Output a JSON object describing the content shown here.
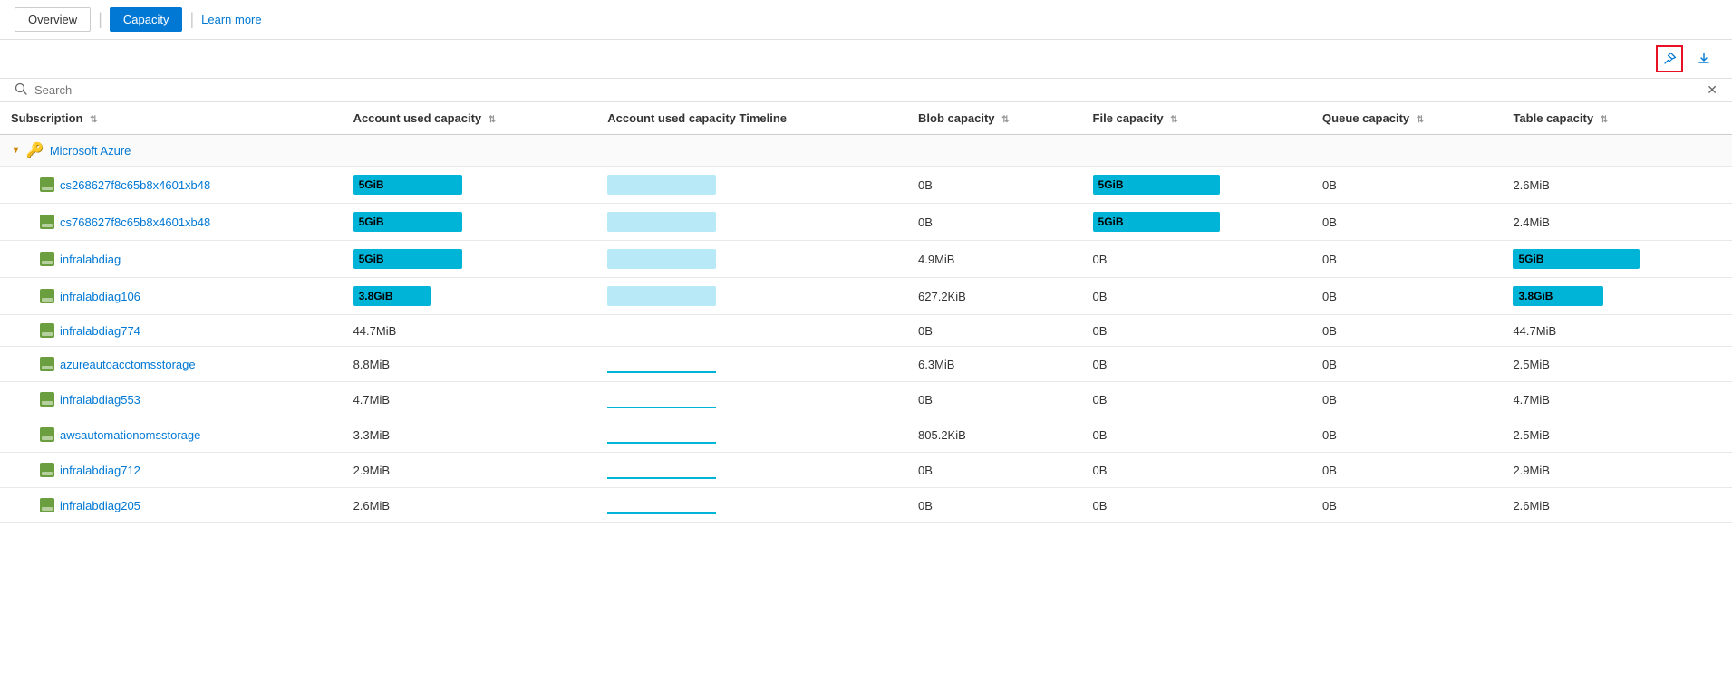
{
  "topbar": {
    "overview_label": "Overview",
    "capacity_label": "Capacity",
    "learn_more_label": "Learn more"
  },
  "toolbar": {
    "pin_icon": "📌",
    "download_icon": "⬇"
  },
  "search": {
    "placeholder": "Search",
    "clear_icon": "✕"
  },
  "table": {
    "columns": [
      {
        "key": "subscription",
        "label": "Subscription"
      },
      {
        "key": "account_used_capacity",
        "label": "Account used capacity"
      },
      {
        "key": "account_used_capacity_timeline",
        "label": "Account used capacity Timeline"
      },
      {
        "key": "blob_capacity",
        "label": "Blob capacity"
      },
      {
        "key": "file_capacity",
        "label": "File capacity"
      },
      {
        "key": "queue_capacity",
        "label": "Queue capacity"
      },
      {
        "key": "table_capacity",
        "label": "Table capacity"
      }
    ],
    "group": {
      "name": "Microsoft Azure"
    },
    "rows": [
      {
        "name": "cs268627f8c65b8x4601xb48",
        "account_used_capacity": "5GiB",
        "account_used_capacity_bar": "full",
        "timeline_bar": "light",
        "blob_capacity": "0B",
        "file_capacity": "5GiB",
        "file_capacity_bar": true,
        "queue_capacity": "0B",
        "table_capacity": "2.6MiB",
        "table_capacity_bar": false
      },
      {
        "name": "cs768627f8c65b8x4601xb48",
        "account_used_capacity": "5GiB",
        "account_used_capacity_bar": "full",
        "timeline_bar": "light",
        "blob_capacity": "0B",
        "file_capacity": "5GiB",
        "file_capacity_bar": true,
        "queue_capacity": "0B",
        "table_capacity": "2.4MiB",
        "table_capacity_bar": false
      },
      {
        "name": "infralabdiag",
        "account_used_capacity": "5GiB",
        "account_used_capacity_bar": "full",
        "timeline_bar": "light",
        "blob_capacity": "4.9MiB",
        "file_capacity": "0B",
        "file_capacity_bar": false,
        "queue_capacity": "0B",
        "table_capacity": "5GiB",
        "table_capacity_bar": true,
        "table_capacity_bar_size": "full"
      },
      {
        "name": "infralabdiag106",
        "account_used_capacity": "3.8GiB",
        "account_used_capacity_bar": "partial",
        "timeline_bar": "light",
        "blob_capacity": "627.2KiB",
        "file_capacity": "0B",
        "file_capacity_bar": false,
        "queue_capacity": "0B",
        "table_capacity": "3.8GiB",
        "table_capacity_bar": true,
        "table_capacity_bar_size": "partial"
      },
      {
        "name": "infralabdiag774",
        "account_used_capacity": "44.7MiB",
        "account_used_capacity_bar": "none",
        "timeline_bar": "none",
        "blob_capacity": "0B",
        "file_capacity": "0B",
        "file_capacity_bar": false,
        "queue_capacity": "0B",
        "table_capacity": "44.7MiB",
        "table_capacity_bar": false
      },
      {
        "name": "azureautoacctomsstorage",
        "account_used_capacity": "8.8MiB",
        "account_used_capacity_bar": "none",
        "timeline_bar": "tiny",
        "blob_capacity": "6.3MiB",
        "file_capacity": "0B",
        "file_capacity_bar": false,
        "queue_capacity": "0B",
        "table_capacity": "2.5MiB",
        "table_capacity_bar": false
      },
      {
        "name": "infralabdiag553",
        "account_used_capacity": "4.7MiB",
        "account_used_capacity_bar": "none",
        "timeline_bar": "tiny",
        "blob_capacity": "0B",
        "file_capacity": "0B",
        "file_capacity_bar": false,
        "queue_capacity": "0B",
        "table_capacity": "4.7MiB",
        "table_capacity_bar": false
      },
      {
        "name": "awsautomationomsstorage",
        "account_used_capacity": "3.3MiB",
        "account_used_capacity_bar": "none",
        "timeline_bar": "tiny",
        "blob_capacity": "805.2KiB",
        "file_capacity": "0B",
        "file_capacity_bar": false,
        "queue_capacity": "0B",
        "table_capacity": "2.5MiB",
        "table_capacity_bar": false
      },
      {
        "name": "infralabdiag712",
        "account_used_capacity": "2.9MiB",
        "account_used_capacity_bar": "none",
        "timeline_bar": "tiny",
        "blob_capacity": "0B",
        "file_capacity": "0B",
        "file_capacity_bar": false,
        "queue_capacity": "0B",
        "table_capacity": "2.9MiB",
        "table_capacity_bar": false
      },
      {
        "name": "infralabdiag205",
        "account_used_capacity": "2.6MiB",
        "account_used_capacity_bar": "none",
        "timeline_bar": "tiny",
        "blob_capacity": "0B",
        "file_capacity": "0B",
        "file_capacity_bar": false,
        "queue_capacity": "0B",
        "table_capacity": "2.6MiB",
        "table_capacity_bar": false
      }
    ]
  }
}
